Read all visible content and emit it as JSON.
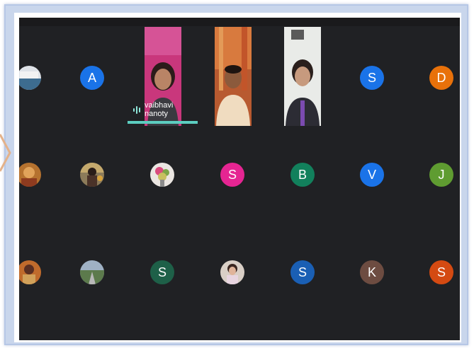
{
  "speaker": {
    "name": "vaibhavi nanoty"
  },
  "participants": {
    "row1": [
      {
        "kind": "photo",
        "name": "participant-1"
      },
      {
        "kind": "initial",
        "letter": "A",
        "color": "#1a73e8"
      },
      {
        "kind": "video",
        "name": "vaibhavi nanoty"
      },
      {
        "kind": "video",
        "name": "participant-video-2"
      },
      {
        "kind": "video",
        "name": "participant-video-3"
      },
      {
        "kind": "initial",
        "letter": "S",
        "color": "#1a73e8"
      },
      {
        "kind": "initial",
        "letter": "D",
        "color": "#e8710a"
      }
    ],
    "row2": [
      {
        "kind": "photo"
      },
      {
        "kind": "photo"
      },
      {
        "kind": "photo"
      },
      {
        "kind": "initial",
        "letter": "S",
        "color": "#e52592"
      },
      {
        "kind": "initial",
        "letter": "B",
        "color": "#12805c"
      },
      {
        "kind": "initial",
        "letter": "V",
        "color": "#1a73e8"
      },
      {
        "kind": "initial",
        "letter": "J",
        "color": "#5f9c31"
      }
    ],
    "row3": [
      {
        "kind": "photo"
      },
      {
        "kind": "photo"
      },
      {
        "kind": "initial",
        "letter": "S",
        "color": "#1e6048"
      },
      {
        "kind": "photo"
      },
      {
        "kind": "initial",
        "letter": "S",
        "color": "#1a5fb4"
      },
      {
        "kind": "initial",
        "letter": "K",
        "color": "#6d4c41"
      },
      {
        "kind": "initial",
        "letter": "S",
        "color": "#d44a12"
      }
    ]
  }
}
